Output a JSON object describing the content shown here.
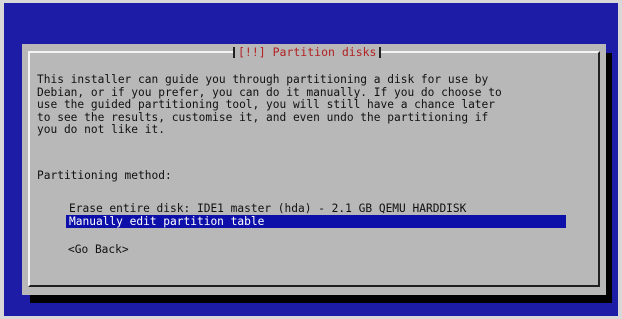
{
  "colors": {
    "screen_background": "#1c1ca6",
    "dialog_background": "#b8b8b8",
    "title_text": "#b22222",
    "selected_background": "#0d10a8",
    "selected_text": "#ffffff"
  },
  "dialog": {
    "title": "[!!] Partition disks",
    "body_lines": [
      "This installer can guide you through partitioning a disk for use by",
      "Debian, or if you prefer, you can do it manually. If you do choose to",
      "use the guided partitioning tool, you will still have a chance later",
      "to see the results, customise it, and even undo the partitioning if",
      "you do not like it."
    ],
    "method_label": "Partitioning method:",
    "options": [
      "Erase entire disk: IDE1 master (hda) - 2.1 GB QEMU HARDDISK",
      "Manually edit partition table"
    ],
    "selected_option": "Manually edit partition table",
    "go_back_label": "<Go Back>"
  }
}
